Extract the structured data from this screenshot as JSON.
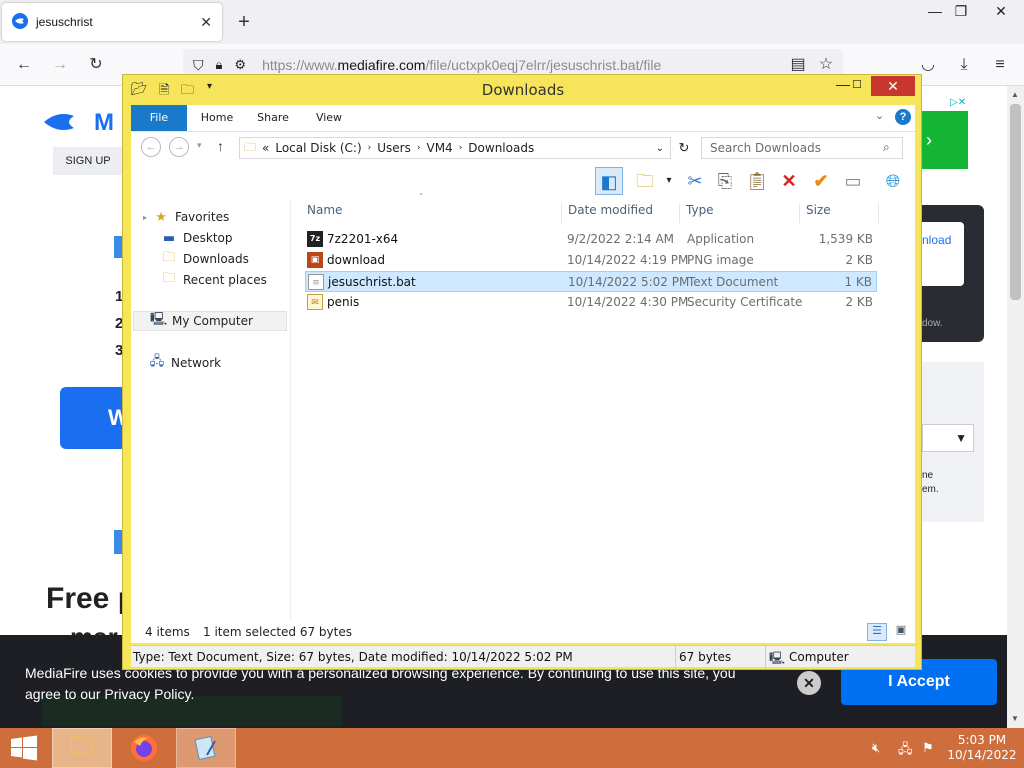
{
  "browser": {
    "tab_title": "jesuschrist",
    "url_prefix": "https://www.",
    "url_domain": "mediafire.com",
    "url_path": "/file/uctxpk0eqj7elrr/jesuschrist.bat/file"
  },
  "mediafire": {
    "sign_up": "SIGN UP",
    "hero_partial": "Free p",
    "hero_partial2": "mar",
    "button_partial": "W",
    "download_partial": "nload",
    "list_nums": [
      "1",
      "2",
      "3"
    ],
    "side_text1": "dow.",
    "side_text2": "ne",
    "side_text3": "em.",
    "cookie_text": "MediaFire uses cookies to provide you with a personalized browsing experience. By continuing to use this site, you agree to our Privacy Policy.",
    "accept": "I Accept"
  },
  "explorer": {
    "title": "Downloads",
    "ribbon_tabs": [
      "File",
      "Home",
      "Share",
      "View"
    ],
    "path": [
      "Local Disk (C:)",
      "Users",
      "VM4",
      "Downloads"
    ],
    "search_placeholder": "Search Downloads",
    "nav": {
      "favorites": "Favorites",
      "desktop": "Desktop",
      "downloads": "Downloads",
      "recent": "Recent places",
      "computer": "My Computer",
      "network": "Network"
    },
    "columns": [
      "Name",
      "Date modified",
      "Type",
      "Size"
    ],
    "files": [
      {
        "name": "7z2201-x64",
        "date": "9/2/2022 2:14 AM",
        "type": "Application",
        "size": "1,539 KB"
      },
      {
        "name": "download",
        "date": "10/14/2022 4:19 PM",
        "type": "PNG image",
        "size": "2 KB"
      },
      {
        "name": "jesuschrist.bat",
        "date": "10/14/2022 5:02 PM",
        "type": "Text Document",
        "size": "1 KB"
      },
      {
        "name": "penis",
        "date": "10/14/2022 4:30 PM",
        "type": "Security Certificate",
        "size": "2 KB"
      }
    ],
    "status_items": "4 items",
    "status_selected": "1 item selected  67 bytes",
    "details": "Type: Text Document, Size: 67 bytes, Date modified: 10/14/2022 5:02 PM",
    "details_size": "67 bytes",
    "details_location": "Computer"
  },
  "taskbar": {
    "time": "5:03 PM",
    "date": "10/14/2022"
  },
  "colors": {
    "explorer_frame": "#f6e55a",
    "close_red": "#c7372f",
    "ribbon_file": "#1979ca",
    "taskbar": "#cf6e3d",
    "accept_blue": "#0070f0",
    "selection": "#cde8ff"
  }
}
